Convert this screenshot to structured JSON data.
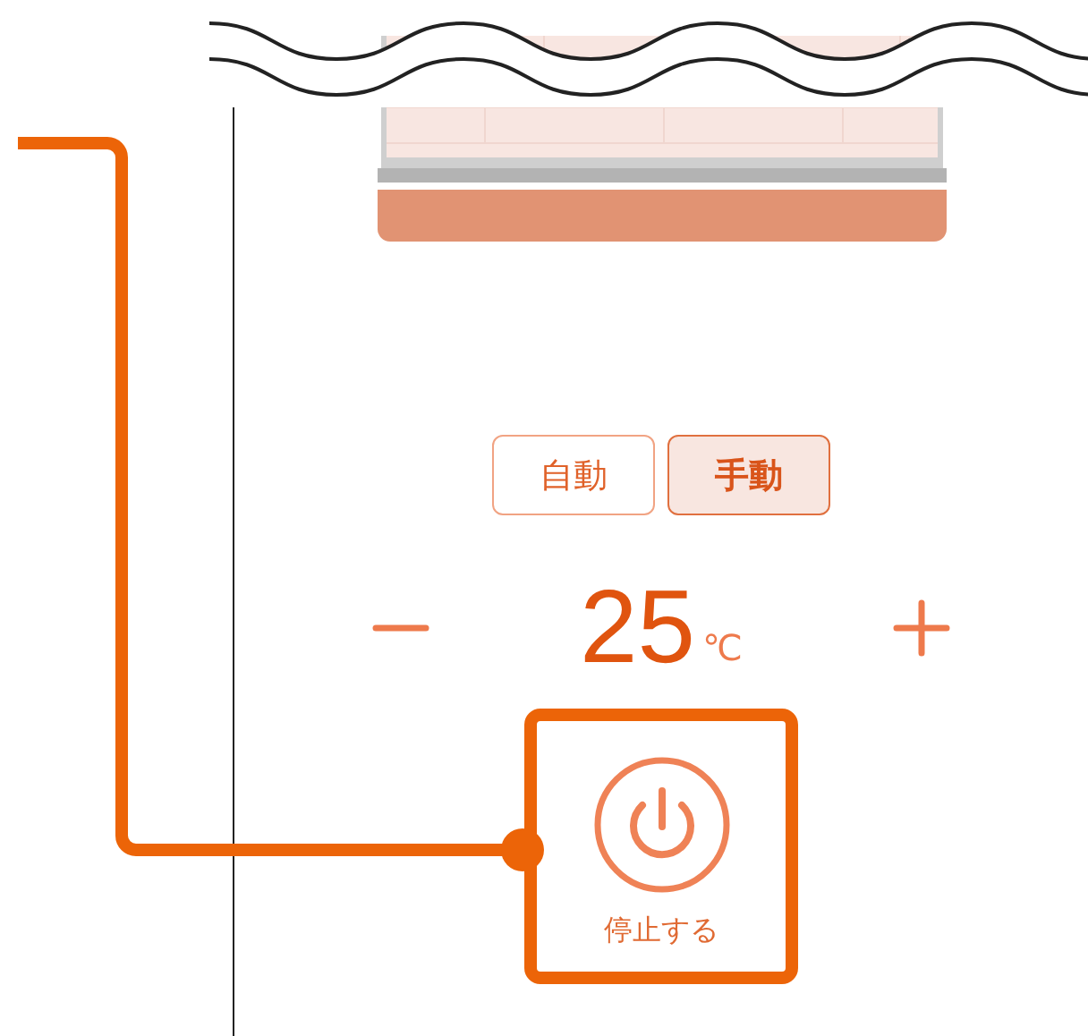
{
  "mode_tabs": [
    {
      "label": "自動",
      "selected": false
    },
    {
      "label": "手動",
      "selected": true
    }
  ],
  "temperature": {
    "value": "25",
    "unit": "℃"
  },
  "power_button": {
    "label": "停止する"
  }
}
